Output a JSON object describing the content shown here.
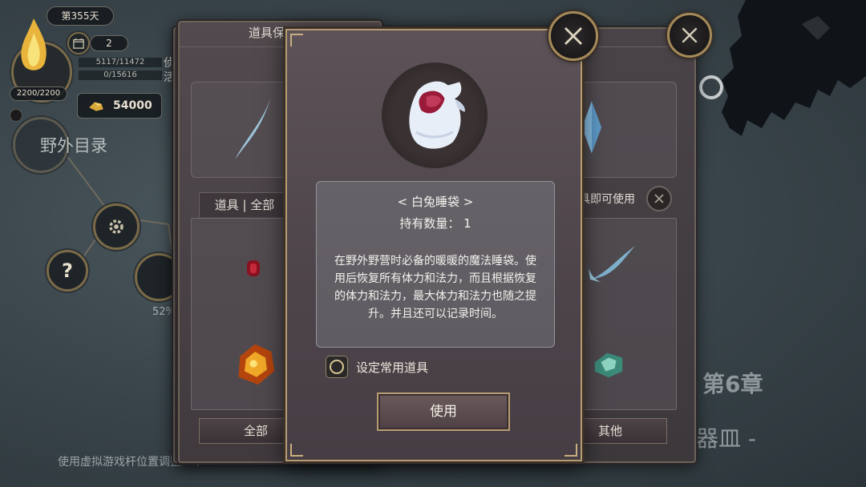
{
  "hud": {
    "day": "第355天",
    "calendar_count": "2",
    "stat1": "5117/11472",
    "stat2": "0/15616",
    "stat1_suffix": "侦",
    "stat2_suffix": "活",
    "gauge": "2200/2200",
    "gold": "54000",
    "location": "野外目录",
    "progress_pct": "52%"
  },
  "map": {
    "chapter": "第6章",
    "subtitle": "神器皿 -"
  },
  "hint": "使用虚拟游戏杆位置调整一下",
  "storage_panel": {
    "title": "道具保险箱",
    "filter": "道具 | 全部",
    "right_hint": "具即可使用",
    "tab_all": "全部",
    "tab_other": "其他"
  },
  "dialog": {
    "item_name": "< 白兔睡袋 >",
    "quantity": "持有数量： 1",
    "description": "在野外野营时必备的暖暖的魔法睡袋。使用后恢复所有体力和法力，而且根据恢复的体力和法力，最大体力和法力也随之提升。并且还可以记录时间。",
    "favorite_label": "设定常用道具",
    "use_button": "使用"
  },
  "colors": {
    "frame_gold": "#b69c72",
    "panel_bg": "#4d444a",
    "map_bg": "#3b474d"
  }
}
